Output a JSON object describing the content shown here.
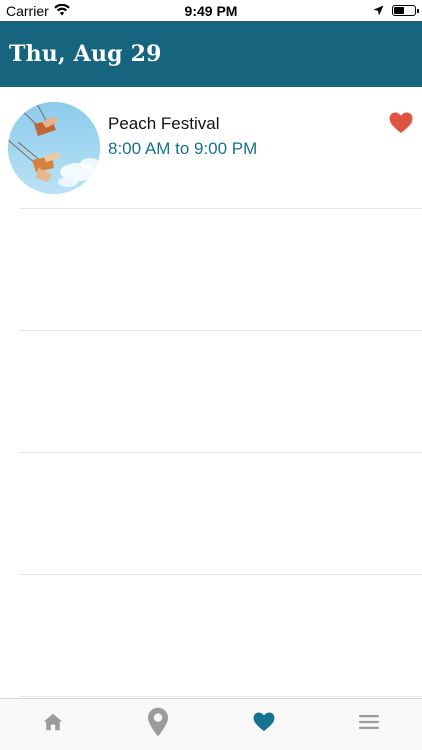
{
  "status_bar": {
    "carrier": "Carrier",
    "time": "9:49 PM"
  },
  "header": {
    "title": "Thu, Aug 29"
  },
  "events": [
    {
      "title": "Peach Festival",
      "time": "8:00 AM to 9:00 PM",
      "favorited": true,
      "image_icon": "swing-ride-photo"
    }
  ],
  "tabbar": {
    "tabs": [
      {
        "icon": "home-icon",
        "active": false
      },
      {
        "icon": "map-pin-icon",
        "active": false
      },
      {
        "icon": "heart-icon",
        "active": true
      },
      {
        "icon": "menu-icon",
        "active": false
      }
    ]
  },
  "colors": {
    "header_bg": "#16647e",
    "accent": "#16738f",
    "favorite": "#e05342",
    "tab_inactive": "#9b9b9b",
    "tab_active": "#16738f"
  }
}
